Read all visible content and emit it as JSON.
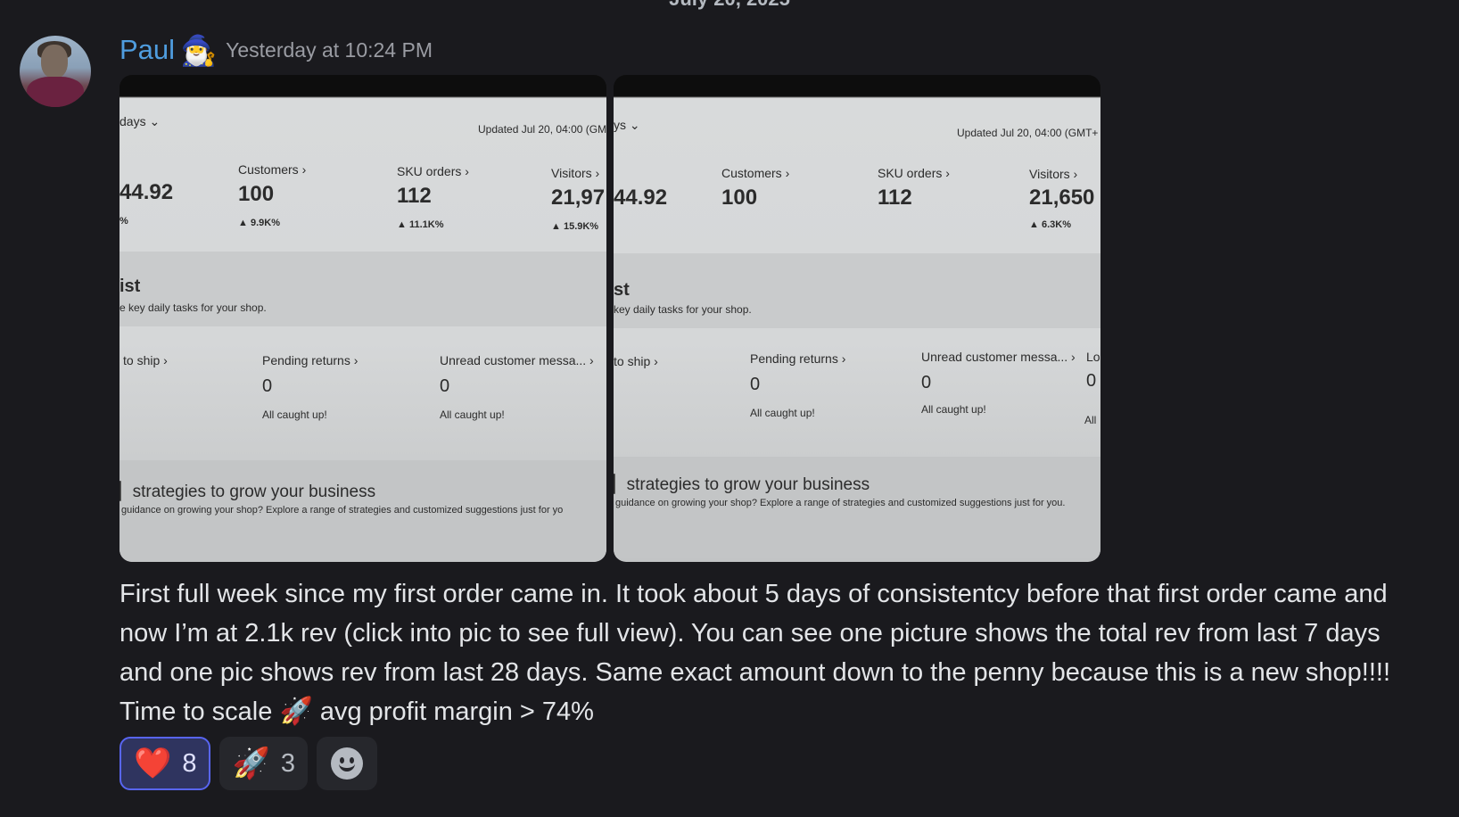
{
  "date_divider": "July 20, 2025",
  "author": {
    "name": "Paul",
    "badge_emoji": "🧙‍♂️"
  },
  "timestamp": "Yesterday at 10:24 PM",
  "attachments": [
    {
      "range": "days",
      "updated": "Updated Jul 20, 04:00 (GM",
      "rev_value": "44.92",
      "rev_pct": "%",
      "metrics": [
        {
          "label": "Customers",
          "value": "100",
          "pct": "9.9K%"
        },
        {
          "label": "SKU orders",
          "value": "112",
          "pct": "11.1K%"
        },
        {
          "label": "Visitors",
          "value": "21,97",
          "pct": "15.9K%"
        }
      ],
      "checklist_title": "ist",
      "checklist_sub": "e key daily tasks for your shop.",
      "tasks": [
        {
          "label": "to ship",
          "value": "",
          "status": ""
        },
        {
          "label": "Pending returns",
          "value": "0",
          "status": "All caught up!"
        },
        {
          "label": "Unread customer messa...",
          "value": "0",
          "status": "All caught up!"
        }
      ],
      "strategies_title": "strategies to grow your business",
      "strategies_sub": "guidance on growing your shop? Explore a range of strategies and customized suggestions just for yo"
    },
    {
      "range": "ys",
      "updated": "Updated Jul 20, 04:00 (GMT+",
      "rev_value": "44.92",
      "rev_pct": "",
      "metrics": [
        {
          "label": "Customers",
          "value": "100",
          "pct": ""
        },
        {
          "label": "SKU orders",
          "value": "112",
          "pct": ""
        },
        {
          "label": "Visitors",
          "value": "21,650",
          "pct": "6.3K%"
        }
      ],
      "checklist_title": "st",
      "checklist_sub": "key daily tasks for your shop.",
      "tasks": [
        {
          "label": "to ship",
          "value": "",
          "status": ""
        },
        {
          "label": "Pending returns",
          "value": "0",
          "status": "All caught up!"
        },
        {
          "label": "Unread customer messa...",
          "value": "0",
          "status": "All caught up!"
        },
        {
          "label": "Lo",
          "value": "0",
          "status": "All"
        }
      ],
      "strategies_title": "strategies to grow your business",
      "strategies_sub": "guidance on growing your shop? Explore a range of strategies and customized suggestions just for you."
    }
  ],
  "message": {
    "text": "First full week since my first order came in. It took about 5 days of consistentcy before that first order came and now I’m at 2.1k rev (click into pic to see full view). You can see one picture shows the total rev from last 7 days and one pic shows rev from last 28 days. Same exact amount down to the penny because this is a new shop!!!! Time to scale",
    "rocket_emoji": "🚀",
    "text_after": "avg profit margin > 74%"
  },
  "reactions": [
    {
      "emoji": "❤️",
      "count": "8",
      "active": true
    },
    {
      "emoji": "🚀",
      "count": "3",
      "active": false
    }
  ],
  "icons": {
    "add_reaction": "smiley-icon",
    "avatar": "user-avatar"
  },
  "colors": {
    "username": "#4f9ddf",
    "active_reaction_border": "#5865f2"
  }
}
